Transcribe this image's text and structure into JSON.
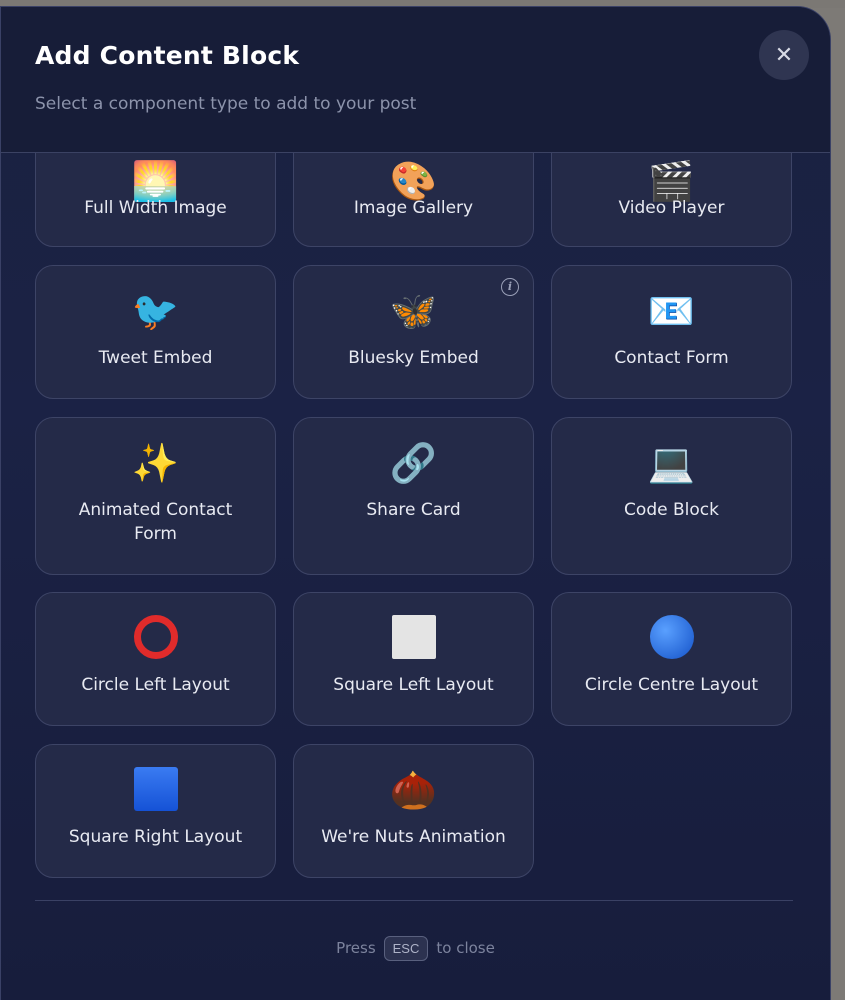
{
  "modal": {
    "title": "Add Content Block",
    "subtitle": "Select a component type to add to your post",
    "close_icon": "close-icon"
  },
  "cards": [
    {
      "label": "Full Width Image",
      "icon": "🌅",
      "icon_name": "sunrise-image-icon"
    },
    {
      "label": "Image Gallery",
      "icon": "🎨",
      "icon_name": "palette-icon"
    },
    {
      "label": "Video Player",
      "icon": "🎬",
      "icon_name": "clapper-board-icon"
    },
    {
      "label": "Tweet Embed",
      "icon": "🐦",
      "icon_name": "bird-icon"
    },
    {
      "label": "Bluesky Embed",
      "icon": "🦋",
      "icon_name": "butterfly-icon",
      "info": "i"
    },
    {
      "label": "Contact Form",
      "icon": "📧",
      "icon_name": "email-icon"
    },
    {
      "label": "Animated Contact Form",
      "icon": "✨",
      "icon_name": "sparkles-icon"
    },
    {
      "label": "Share Card",
      "icon": "🔗",
      "icon_name": "link-icon"
    },
    {
      "label": "Code Block",
      "icon": "💻",
      "icon_name": "laptop-icon"
    },
    {
      "label": "Circle Left Layout",
      "icon": "",
      "icon_name": "red-circle-icon"
    },
    {
      "label": "Square Left Layout",
      "icon": "",
      "icon_name": "white-square-icon"
    },
    {
      "label": "Circle Centre Layout",
      "icon": "",
      "icon_name": "blue-circle-icon"
    },
    {
      "label": "Square Right Layout",
      "icon": "",
      "icon_name": "blue-square-icon"
    },
    {
      "label": "We're Nuts Animation",
      "icon": "🌰",
      "icon_name": "chestnut-icon"
    }
  ],
  "footer": {
    "press": "Press",
    "key": "ESC",
    "to_close": "to close"
  },
  "colors": {
    "modal_bg": "#1b2245",
    "card_bg": "#242a48",
    "card_border": "#3d4466"
  }
}
